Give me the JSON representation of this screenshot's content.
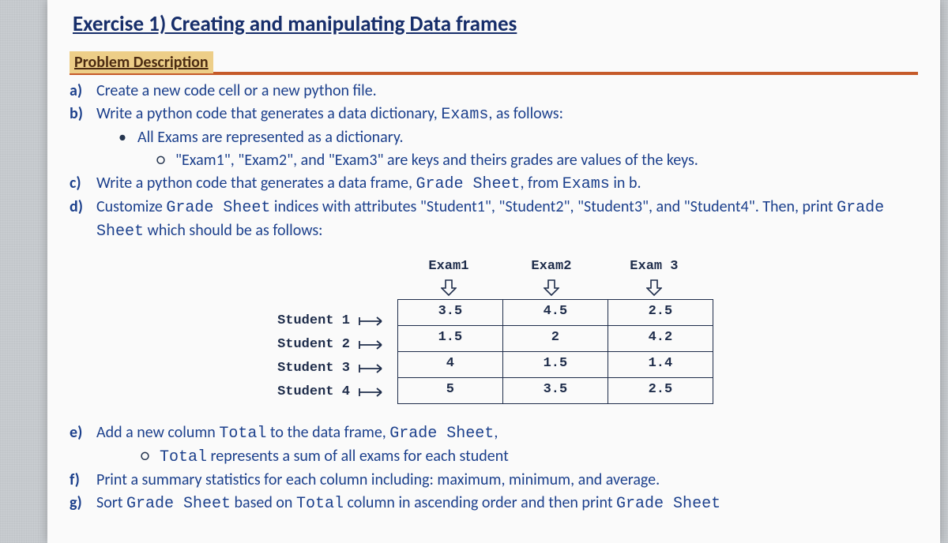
{
  "title": "Exercise 1) Creating and manipulating Data frames",
  "section_heading": "Problem Description",
  "items": {
    "a": {
      "marker": "a)",
      "text": "Create a new code cell or a new python file."
    },
    "b": {
      "marker": "b)",
      "text_pre": "Write a python code that generates a data dictionary, ",
      "code": "Exams",
      "text_post": ", as follows:"
    },
    "b_sub1": "All Exams are represented as a dictionary.",
    "b_sub2": "\"Exam1\", \"Exam2\", and \"Exam3\" are keys and theirs grades are values of the keys.",
    "c": {
      "marker": "c)",
      "pre": "Write a python code that generates a data frame, ",
      "code": "Grade Sheet",
      "mid": ", from ",
      "code2": "Exams",
      "post": " in b."
    },
    "d": {
      "marker": "d)",
      "pre": "Customize ",
      "code": "Grade Sheet",
      "mid": " indices with attributes \"Student1\", \"Student2\", \"Student3\", and \"Student4\". Then, print ",
      "code2": "Grade Sheet",
      "post": " which should be as follows:"
    },
    "e": {
      "marker": "e)",
      "pre": "Add a new column ",
      "code": "Total",
      "mid": " to the data frame, ",
      "code2": "Grade Sheet",
      "post": ","
    },
    "e_sub": {
      "code": "Total",
      "text": " represents a sum of all exams for each student"
    },
    "f": {
      "marker": "f)",
      "text": "Print a summary statistics for each column including: maximum, minimum, and average."
    },
    "g": {
      "marker": "g)",
      "pre": "Sort ",
      "code": "Grade Sheet",
      "mid": " based on ",
      "code2": "Total",
      "post": " column in ascending order and then print ",
      "code3": "Grade Sheet"
    }
  },
  "chart_data": {
    "type": "table",
    "col_headers": [
      "Exam1",
      "Exam2",
      "Exam 3"
    ],
    "row_headers": [
      "Student 1",
      "Student 2",
      "Student 3",
      "Student   4"
    ],
    "rows": [
      [
        "3.5",
        "4.5",
        "2.5"
      ],
      [
        "1.5",
        "2",
        "4.2"
      ],
      [
        "4",
        "1.5",
        "1.4"
      ],
      [
        "5",
        "3.5",
        "2.5"
      ]
    ]
  }
}
